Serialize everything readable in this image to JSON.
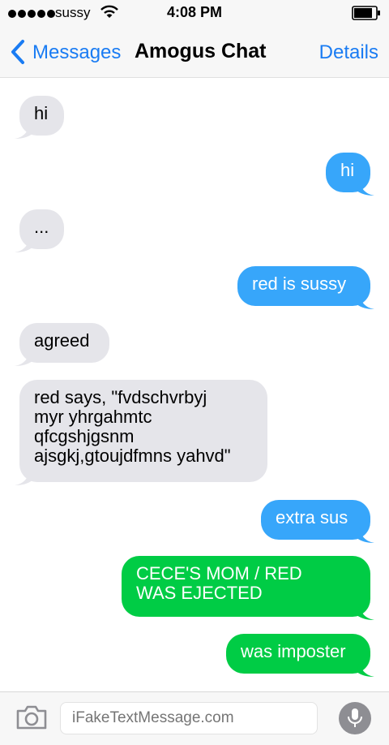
{
  "status_bar": {
    "carrier": "sussy",
    "time": "4:08 PM",
    "signal_bars": 5
  },
  "nav": {
    "back_label": "Messages",
    "title": "Amogus Chat",
    "details_label": "Details"
  },
  "messages": [
    {
      "direction": "incoming",
      "text": "hi"
    },
    {
      "direction": "outgoing",
      "color": "#37a6fa",
      "text": "hi"
    },
    {
      "direction": "incoming",
      "text": "..."
    },
    {
      "direction": "outgoing",
      "color": "#37a6fa",
      "text": "red is sussy"
    },
    {
      "direction": "incoming",
      "text": "agreed"
    },
    {
      "direction": "incoming",
      "text": "red says, \"fvdschvrbyj\nmyr yhrgahmtc\nqfcgshjgsnm\najsgkj,gtoujdfmns yahvd\""
    },
    {
      "direction": "outgoing",
      "color": "#37a6fa",
      "text": "extra sus"
    },
    {
      "direction": "outgoing",
      "color": "#00cc45",
      "text": "CECE'S MOM / RED\nWAS EJECTED"
    },
    {
      "direction": "outgoing",
      "color": "#00cc45",
      "text": "was imposter"
    }
  ],
  "input_bar": {
    "placeholder": "iFakeTextMessage.com"
  },
  "icons": {
    "camera": "camera-icon",
    "microphone": "microphone-icon",
    "back": "chevron-left-icon",
    "wifi": "wifi-icon",
    "battery": "battery-icon"
  },
  "colors": {
    "accent": "#1a7cf3",
    "incoming_bubble": "#e5e5ea",
    "imessage_blue": "#37a6fa",
    "sms_green": "#00cc45"
  }
}
